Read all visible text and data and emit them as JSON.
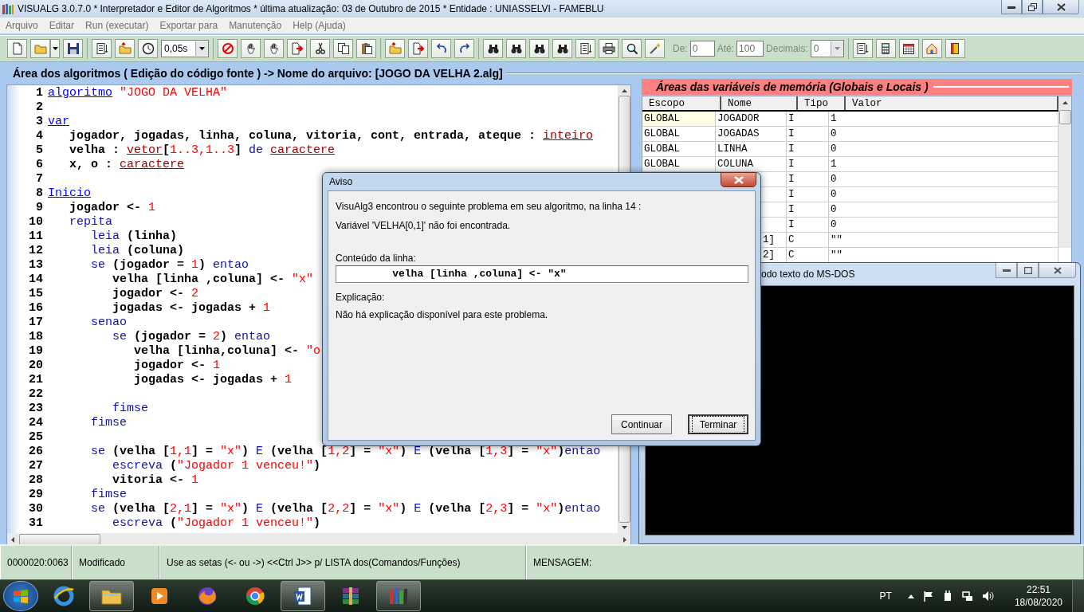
{
  "window": {
    "title": "VISUALG 3.0.7.0 * Interpretador e Editor de Algoritmos * última atualização: 03 de Outubro de 2015 * Entidade : UNIASSELVI - FAMEBLU"
  },
  "menu": [
    "Arquivo",
    "Editar",
    "Run (executar)",
    "Exportar para",
    "Manutenção",
    "Help (Ajuda)"
  ],
  "toolbar": {
    "speed": "0,05s",
    "range_disabled": true,
    "from_label": "De:",
    "from": "0",
    "to_label": "Até:",
    "to": "100",
    "decimals_label": "Decimais:",
    "decimals": "0"
  },
  "editor": {
    "title": "Área dos algoritmos ( Edição do código fonte ) -> Nome do arquivo: [JOGO DA VELHA 2.alg]",
    "lines": [
      {
        "number": "1",
        "tokens": [
          {
            "kind": "keyword",
            "text": "algoritmo"
          },
          {
            "kind": "literal",
            "text": " \"JOGO DA VELHA\""
          }
        ]
      },
      {
        "number": "2"
      },
      {
        "number": "3",
        "tokens": [
          {
            "kind": "keyword",
            "text": "var"
          }
        ]
      },
      {
        "number": "4",
        "tokens": [
          {
            "kind": "text",
            "text": "   jogador, jogadas, linha, coluna, vitoria, cont, entrada, ateque : "
          },
          {
            "kind": "type",
            "text": "inteiro"
          }
        ]
      },
      {
        "number": "5",
        "tokens": [
          {
            "kind": "text",
            "text": "   velha : "
          },
          {
            "kind": "type",
            "text": "vetor"
          },
          {
            "kind": "text",
            "text": "["
          },
          {
            "kind": "literal",
            "text": "1..3,1..3"
          },
          {
            "kind": "text",
            "text": "] "
          },
          {
            "kind": "command",
            "text": "de "
          },
          {
            "kind": "type",
            "text": "caractere"
          }
        ]
      },
      {
        "number": "6",
        "tokens": [
          {
            "kind": "text",
            "text": "   x, o : "
          },
          {
            "kind": "type",
            "text": "caractere"
          }
        ]
      },
      {
        "number": "7"
      },
      {
        "number": "8",
        "tokens": [
          {
            "kind": "keyword",
            "text": "Inicio"
          }
        ]
      },
      {
        "number": "9",
        "tokens": [
          {
            "kind": "text",
            "text": "   jogador <- "
          },
          {
            "kind": "literal",
            "text": "1"
          }
        ]
      },
      {
        "number": "10",
        "tokens": [
          {
            "kind": "command",
            "text": "   repita"
          }
        ]
      },
      {
        "number": "11",
        "tokens": [
          {
            "kind": "command",
            "text": "      leia"
          },
          {
            "kind": "text",
            "text": " (linha)"
          }
        ]
      },
      {
        "number": "12",
        "tokens": [
          {
            "kind": "command",
            "text": "      leia"
          },
          {
            "kind": "text",
            "text": " (coluna)"
          }
        ]
      },
      {
        "number": "13",
        "tokens": [
          {
            "kind": "command",
            "text": "      se"
          },
          {
            "kind": "text",
            "text": " (jogador = "
          },
          {
            "kind": "literal",
            "text": "1"
          },
          {
            "kind": "text",
            "text": ") "
          },
          {
            "kind": "command",
            "text": "entao"
          }
        ]
      },
      {
        "number": "14",
        "tokens": [
          {
            "kind": "text",
            "text": "         velha [linha ,coluna] <- "
          },
          {
            "kind": "literal",
            "text": "\"x\""
          }
        ]
      },
      {
        "number": "15",
        "tokens": [
          {
            "kind": "text",
            "text": "         jogador <- "
          },
          {
            "kind": "literal",
            "text": "2"
          }
        ]
      },
      {
        "number": "16",
        "tokens": [
          {
            "kind": "text",
            "text": "         jogadas <- jogadas + "
          },
          {
            "kind": "literal",
            "text": "1"
          }
        ]
      },
      {
        "number": "17",
        "tokens": [
          {
            "kind": "command",
            "text": "      senao"
          }
        ]
      },
      {
        "number": "18",
        "tokens": [
          {
            "kind": "command",
            "text": "         se"
          },
          {
            "kind": "text",
            "text": " (jogador = "
          },
          {
            "kind": "literal",
            "text": "2"
          },
          {
            "kind": "text",
            "text": ") "
          },
          {
            "kind": "command",
            "text": "entao"
          }
        ]
      },
      {
        "number": "19",
        "tokens": [
          {
            "kind": "text",
            "text": "            velha [linha,coluna] <- "
          },
          {
            "kind": "literal",
            "text": "\"o"
          }
        ]
      },
      {
        "number": "20",
        "tokens": [
          {
            "kind": "text",
            "text": "            jogador <- "
          },
          {
            "kind": "literal",
            "text": "1"
          }
        ]
      },
      {
        "number": "21",
        "tokens": [
          {
            "kind": "text",
            "text": "            jogadas <- jogadas + "
          },
          {
            "kind": "literal",
            "text": "1"
          }
        ]
      },
      {
        "number": "22"
      },
      {
        "number": "23",
        "tokens": [
          {
            "kind": "command",
            "text": "         fimse"
          }
        ]
      },
      {
        "number": "24",
        "tokens": [
          {
            "kind": "command",
            "text": "      fimse"
          }
        ]
      },
      {
        "number": "25"
      },
      {
        "number": "26",
        "tokens": [
          {
            "kind": "command",
            "text": "      se"
          },
          {
            "kind": "text",
            "text": " (velha ["
          },
          {
            "kind": "literal",
            "text": "1,1"
          },
          {
            "kind": "text",
            "text": "] = "
          },
          {
            "kind": "literal",
            "text": "\"x\""
          },
          {
            "kind": "text",
            "text": ") "
          },
          {
            "kind": "command",
            "text": "E"
          },
          {
            "kind": "text",
            "text": " (velha ["
          },
          {
            "kind": "literal",
            "text": "1,2"
          },
          {
            "kind": "text",
            "text": "] = "
          },
          {
            "kind": "literal",
            "text": "\"x\""
          },
          {
            "kind": "text",
            "text": ") "
          },
          {
            "kind": "command",
            "text": "E"
          },
          {
            "kind": "text",
            "text": " (velha ["
          },
          {
            "kind": "literal",
            "text": "1,3"
          },
          {
            "kind": "text",
            "text": "] = "
          },
          {
            "kind": "literal",
            "text": "\"x\""
          },
          {
            "kind": "text",
            "text": ")"
          },
          {
            "kind": "command",
            "text": "entao"
          }
        ]
      },
      {
        "number": "27",
        "tokens": [
          {
            "kind": "command",
            "text": "         escreva"
          },
          {
            "kind": "text",
            "text": " ("
          },
          {
            "kind": "literal",
            "text": "\"Jogador 1 venceu!\""
          },
          {
            "kind": "text",
            "text": ")"
          }
        ]
      },
      {
        "number": "28",
        "tokens": [
          {
            "kind": "text",
            "text": "         vitoria <- "
          },
          {
            "kind": "literal",
            "text": "1"
          }
        ]
      },
      {
        "number": "29",
        "tokens": [
          {
            "kind": "command",
            "text": "      fimse"
          }
        ]
      },
      {
        "number": "30",
        "tokens": [
          {
            "kind": "command",
            "text": "      se"
          },
          {
            "kind": "text",
            "text": " (velha ["
          },
          {
            "kind": "literal",
            "text": "2,1"
          },
          {
            "kind": "text",
            "text": "] = "
          },
          {
            "kind": "literal",
            "text": "\"x\""
          },
          {
            "kind": "text",
            "text": ") "
          },
          {
            "kind": "command",
            "text": "E"
          },
          {
            "kind": "text",
            "text": " (velha ["
          },
          {
            "kind": "literal",
            "text": "2,2"
          },
          {
            "kind": "text",
            "text": "] = "
          },
          {
            "kind": "literal",
            "text": "\"x\""
          },
          {
            "kind": "text",
            "text": ") "
          },
          {
            "kind": "command",
            "text": "E"
          },
          {
            "kind": "text",
            "text": " (velha ["
          },
          {
            "kind": "literal",
            "text": "2,3"
          },
          {
            "kind": "text",
            "text": "] = "
          },
          {
            "kind": "literal",
            "text": "\"x\""
          },
          {
            "kind": "text",
            "text": ")"
          },
          {
            "kind": "command",
            "text": "entao"
          }
        ]
      },
      {
        "number": "31",
        "tokens": [
          {
            "kind": "command",
            "text": "         escreva"
          },
          {
            "kind": "text",
            "text": " ("
          },
          {
            "kind": "literal",
            "text": "\"Jogador 1 venceu!\""
          },
          {
            "kind": "text",
            "text": ")"
          }
        ]
      }
    ]
  },
  "variables": {
    "title": "Áreas das variáveis de memória (Globais e Locais )",
    "columns": [
      "Escopo",
      "Nome",
      "Tipo",
      "Valor"
    ],
    "rows": [
      {
        "scope": "GLOBAL",
        "name": "JOGADOR",
        "type": "I",
        "value": "1",
        "focused": true
      },
      {
        "scope": "GLOBAL",
        "name": "JOGADAS",
        "type": "I",
        "value": "0",
        "focused": false
      },
      {
        "scope": "GLOBAL",
        "name": "LINHA",
        "type": "I",
        "value": "0",
        "focused": false
      },
      {
        "scope": "GLOBAL",
        "name": "COLUNA",
        "type": "I",
        "value": "1",
        "focused": false
      },
      {
        "type": "I",
        "value": "0"
      },
      {
        "type": "I",
        "value": "0"
      },
      {
        "type": "I",
        "value": "0"
      },
      {
        "type": "I",
        "value": "0"
      },
      {
        "name": "1]",
        "type": "C",
        "value": "\"\""
      },
      {
        "name": "2]",
        "type": "C",
        "value": "\"\""
      }
    ]
  },
  "dos_window": {
    "title": "odo texto do MS-DOS"
  },
  "dialog": {
    "title": "Aviso",
    "message": "VisuAlg3 encontrou o seguinte problema em seu algoritmo, na linha 14 :",
    "detail": "Variável 'VELHA[0,1]' não foi encontrada.",
    "line_label": "Conteúdo da linha:",
    "line_content": "         velha [linha ,coluna] <- \"x\"",
    "explanation_label": "Explicação:",
    "explanation": "Não há explicação disponível para este problema.",
    "buttons": [
      {
        "label": "Continuar",
        "focused": false
      },
      {
        "label": "Terminar",
        "focused": true
      }
    ]
  },
  "status_bar": [
    "0000020:0063",
    "Modificado",
    "Use as setas (<- ou ->) <<Ctrl J>> p/ LISTA dos(Comandos/Funções)",
    "MENSAGEM:"
  ],
  "taskbar": {
    "apps": [
      {
        "kind": "browser",
        "running": false
      },
      {
        "kind": "folder",
        "running": true
      },
      {
        "kind": "media",
        "running": false
      },
      {
        "kind": "fox",
        "running": false
      },
      {
        "kind": "wheel",
        "running": false
      },
      {
        "kind": "document",
        "running": true
      },
      {
        "kind": "archive",
        "running": false
      },
      {
        "kind": "books",
        "running": true
      }
    ],
    "language": "PT",
    "time": "22:51",
    "date": "18/08/2020"
  }
}
